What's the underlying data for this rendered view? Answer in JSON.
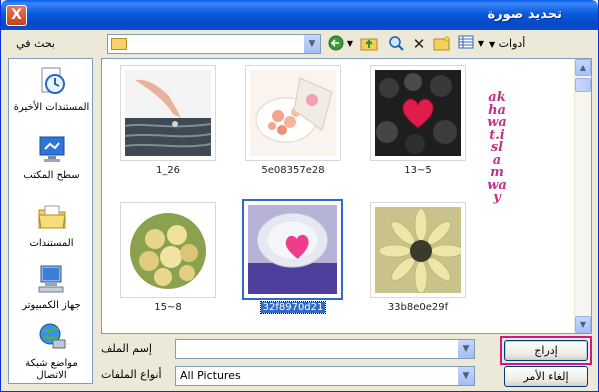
{
  "window": {
    "title": "تحديد صورة",
    "close_label": "X"
  },
  "toolbar": {
    "look_in_label": "بحث في",
    "look_in_value": "",
    "tools_label": "أدوات"
  },
  "places": [
    {
      "label": "المستندات الأخيرة",
      "icon": "recent-documents-icon"
    },
    {
      "label": "سطح المكتب",
      "icon": "desktop-icon"
    },
    {
      "label": "المستندات",
      "icon": "my-documents-icon"
    },
    {
      "label": "جهاز الكمبيوتر",
      "icon": "my-computer-icon"
    },
    {
      "label": "مواضع شبكة الاتصال",
      "icon": "network-places-icon"
    }
  ],
  "files": [
    {
      "name": "1_26"
    },
    {
      "name": "5e08357e28"
    },
    {
      "name": "13~5"
    },
    {
      "name": "15~8"
    },
    {
      "name": "32f8970d21",
      "selected": true
    },
    {
      "name": "33b8e0e29f"
    }
  ],
  "watermark": "akhawat.islamway",
  "form": {
    "filename_label": "إسم الملف",
    "filename_value": "",
    "filetype_label": "أنواع الملفات",
    "filetype_value": "All Pictures",
    "insert_button": "إدراج",
    "cancel_button": "إلغاء الأمر"
  },
  "colors": {
    "titlebar": "#0a5bdc",
    "selection": "#316ac5",
    "highlight_box": "#d51881",
    "watermark": "#c0328b"
  }
}
